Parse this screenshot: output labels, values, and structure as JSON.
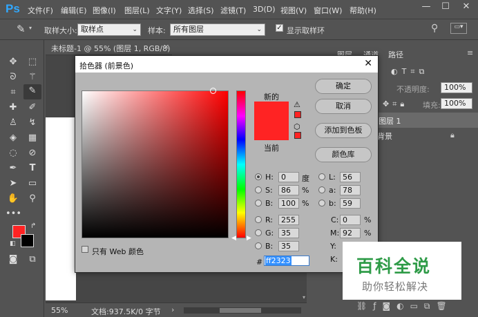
{
  "menubar": {
    "logo": "Ps",
    "items": [
      "文件(F)",
      "编辑(E)",
      "图像(I)",
      "图层(L)",
      "文字(Y)",
      "选择(S)",
      "滤镜(T)",
      "3D(D)",
      "视图(V)",
      "窗口(W)",
      "帮助(H)"
    ]
  },
  "options": {
    "sample_size_label": "取样大小:",
    "sample_size_value": "取样点",
    "sample_label": "样本:",
    "sample_value": "所有图层",
    "show_ring_label": "显示取样环"
  },
  "doc": {
    "tab_title": "未标题-1 @ 55% (图层 1, RGB/8) *",
    "zoom": "55%",
    "doc_info": "文档:937.5K/0 字节"
  },
  "panel": {
    "tabs": [
      "图层",
      "通道",
      "路径"
    ],
    "opacity_label": "不透明度:",
    "opacity_value": "100%",
    "fill_label": "填充:",
    "fill_value": "100%",
    "layers": [
      "图层 1",
      "背景"
    ]
  },
  "dialog": {
    "title": "拾色器 (前景色)",
    "new_label": "新的",
    "current_label": "当前",
    "ok": "确定",
    "cancel": "取消",
    "add_swatch": "添加到色板",
    "color_libraries": "颜色库",
    "web_only": "只有 Web 颜色",
    "fields": {
      "H": {
        "label": "H:",
        "value": "0",
        "unit": "度"
      },
      "S": {
        "label": "S:",
        "value": "86",
        "unit": "%"
      },
      "B": {
        "label": "B:",
        "value": "100",
        "unit": "%"
      },
      "R": {
        "label": "R:",
        "value": "255"
      },
      "G": {
        "label": "G:",
        "value": "35"
      },
      "Bl": {
        "label": "B:",
        "value": "35"
      },
      "L": {
        "label": "L:",
        "value": "56"
      },
      "a": {
        "label": "a:",
        "value": "78"
      },
      "b": {
        "label": "b:",
        "value": "59"
      },
      "C": {
        "label": "C:",
        "value": "0",
        "unit": "%"
      },
      "M": {
        "label": "M:",
        "value": "92",
        "unit": "%"
      },
      "Y": {
        "label": "Y:"
      },
      "K": {
        "label": "K:"
      }
    },
    "hex_label": "#",
    "hex_value": "ff2323",
    "new_color": "#ff2323",
    "current_color": "#ff2323"
  },
  "colors": {
    "foreground": "#ff2323",
    "background": "#000000",
    "accent": "#31a8ff"
  },
  "watermark": {
    "title": "百科全说",
    "subtitle": "助你轻松解决"
  }
}
